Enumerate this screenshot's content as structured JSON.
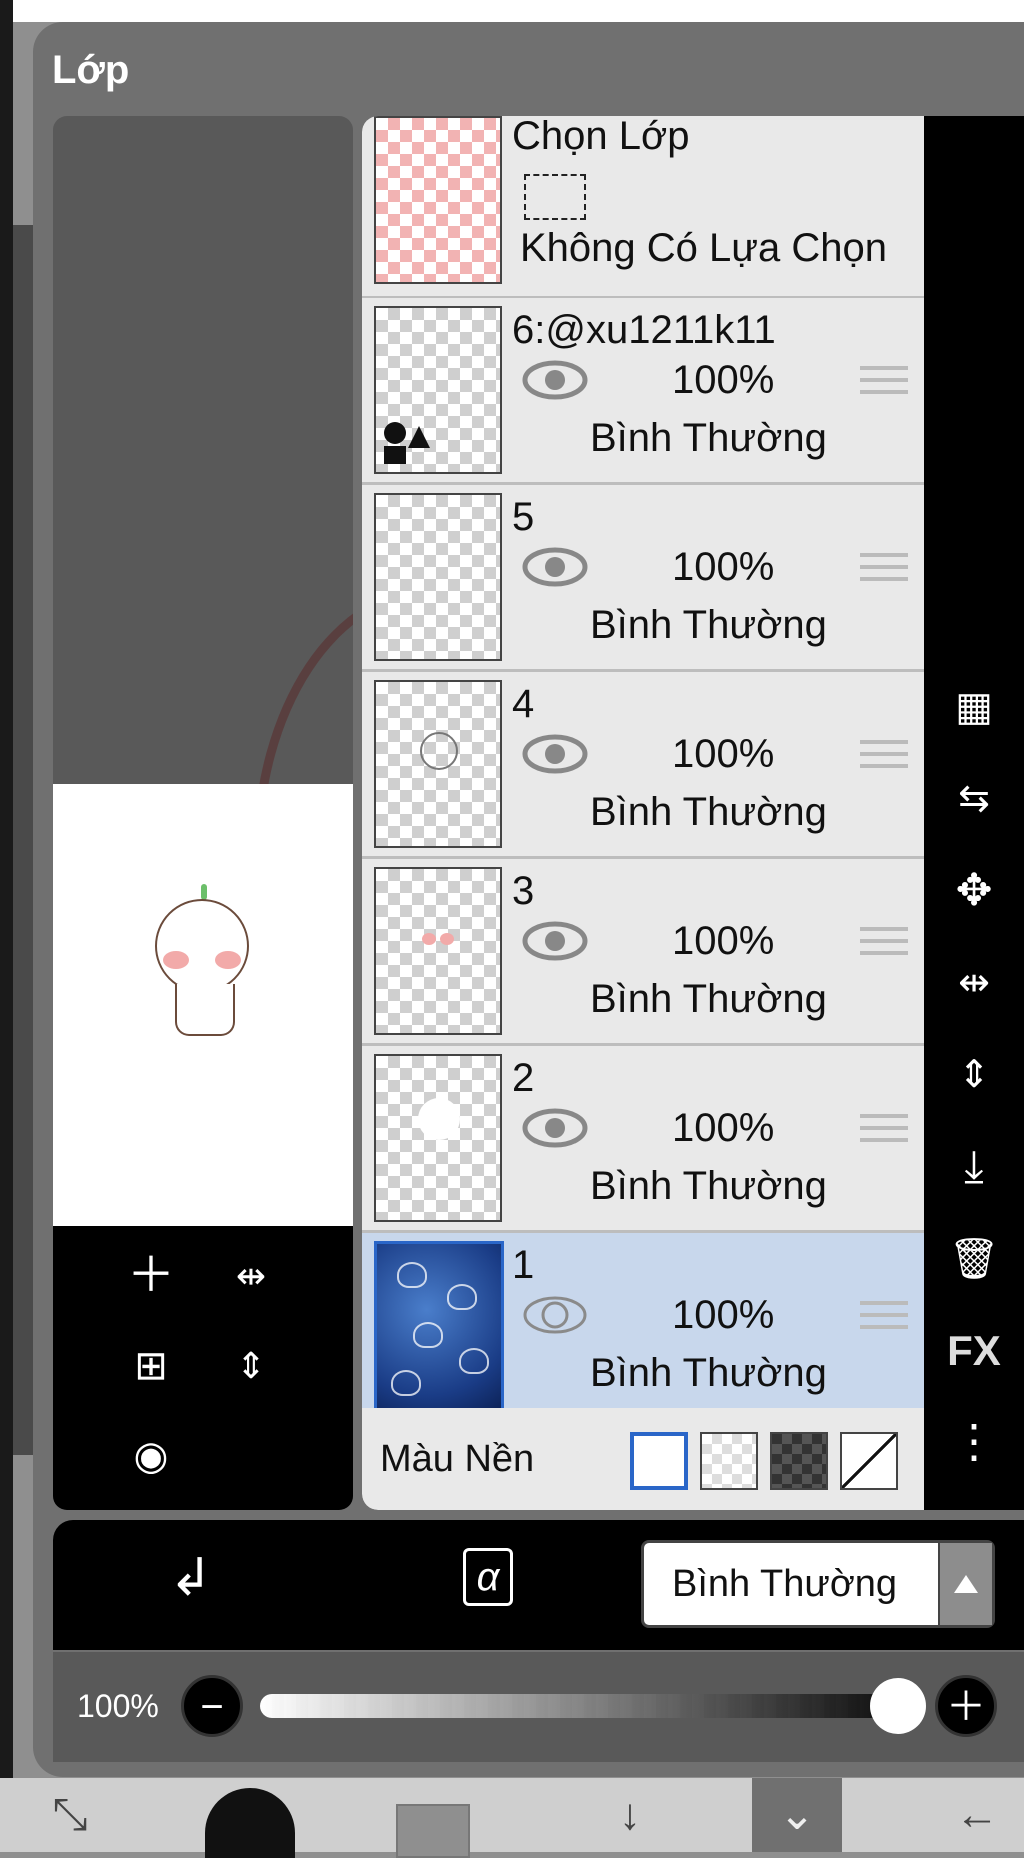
{
  "panel": {
    "title": "Lớp"
  },
  "layers": {
    "selection": {
      "name": "Chọn Lớp",
      "status": "Không Có Lựa Chọn"
    },
    "items": [
      {
        "name": "6:@xu1211k11",
        "opacity": "100%",
        "blend": "Bình Thường",
        "selected": false
      },
      {
        "name": "5",
        "opacity": "100%",
        "blend": "Bình Thường",
        "selected": false
      },
      {
        "name": "4",
        "opacity": "100%",
        "blend": "Bình Thường",
        "selected": false
      },
      {
        "name": "3",
        "opacity": "100%",
        "blend": "Bình Thường",
        "selected": false
      },
      {
        "name": "2",
        "opacity": "100%",
        "blend": "Bình Thường",
        "selected": false
      },
      {
        "name": "1",
        "opacity": "100%",
        "blend": "Bình Thường",
        "selected": true
      }
    ]
  },
  "background": {
    "label": "Màu Nền"
  },
  "side_tools": {
    "fx_label": "FX"
  },
  "left_tools": {
    "fx_label": "FX"
  },
  "blend_mode": {
    "value": "Bình Thường"
  },
  "opacity": {
    "label": "100%",
    "value_percent": 100
  },
  "colors": {
    "selected_row": "#c8d7ec",
    "row": "#e9e9e9",
    "accent": "#2a66c8"
  }
}
